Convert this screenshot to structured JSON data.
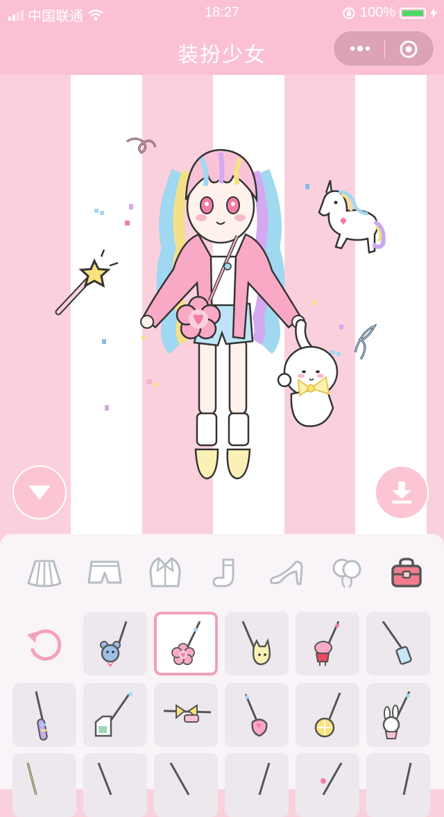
{
  "status_bar": {
    "carrier": "中国联通",
    "time": "18:27",
    "battery_percent": "100%"
  },
  "nav": {
    "title": "装扮少女"
  },
  "colors": {
    "pink_bar": "#fbc1d2",
    "stripe_pink": "#fbd0dd",
    "stripe_white": "#ffffff",
    "panel_bg": "#f8f4f8",
    "selected_border": "#f0a0bd"
  },
  "categories": [
    {
      "name": "skirt-icon"
    },
    {
      "name": "shorts-icon"
    },
    {
      "name": "jacket-icon"
    },
    {
      "name": "sock-icon"
    },
    {
      "name": "high-heel-icon"
    },
    {
      "name": "balloon-icon"
    },
    {
      "name": "bag-icon",
      "active": true
    }
  ],
  "bag_items": [
    {
      "name": "bear-bag"
    },
    {
      "name": "flower-bag",
      "selected": true
    },
    {
      "name": "cat-bag"
    },
    {
      "name": "peppa-pig-bag"
    },
    {
      "name": "bottle-bag"
    },
    {
      "name": "rainbow-wand-bag"
    },
    {
      "name": "milk-carton-bag"
    },
    {
      "name": "bow-belt-bag"
    },
    {
      "name": "heart-cube-bag"
    },
    {
      "name": "lemon-bag"
    },
    {
      "name": "bunny-bag"
    }
  ]
}
